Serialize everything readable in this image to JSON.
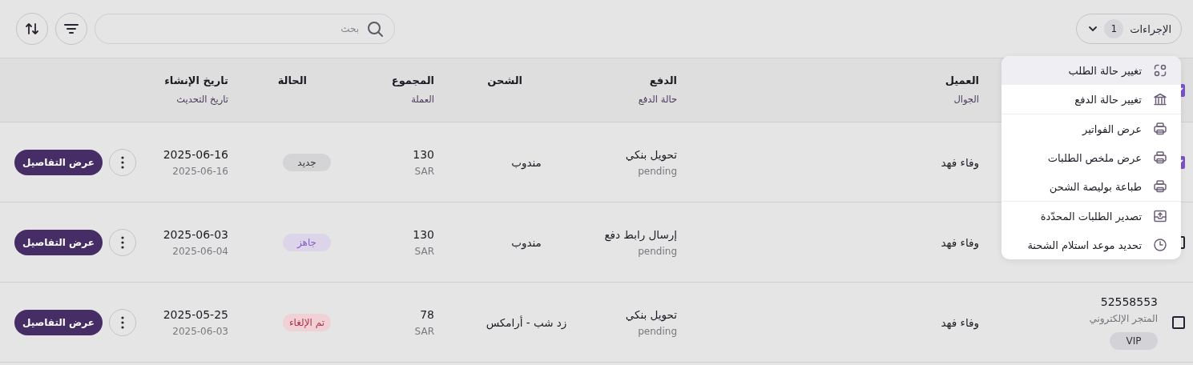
{
  "toolbar": {
    "actions_button": {
      "label": "الإجراءات",
      "count": "1"
    },
    "search": {
      "placeholder": "بحث"
    }
  },
  "table": {
    "header_checkbox": {
      "checked": true
    },
    "columns": [
      {
        "title": "العميل",
        "subtitle": "الجوال"
      },
      {
        "title": "الدفع",
        "subtitle": "حالة الدفع"
      },
      {
        "title": "الشحن"
      },
      {
        "title": "المجموع",
        "subtitle": "العملة"
      },
      {
        "title": "الحالة"
      },
      {
        "title": "تاريخ الإنشاء",
        "subtitle": "تاريخ التحديث"
      }
    ],
    "rows": [
      {
        "checked": true,
        "customer": "وفاء فهد",
        "payment_method": "تحويل بنكي",
        "payment_status": "pending",
        "shipping": "مندوب",
        "total": "130",
        "currency": "SAR",
        "status": {
          "label": "جديد",
          "kind": "new"
        },
        "created": "2025-06-16",
        "updated": "2025-06-16",
        "details_button": "عرض التفاصيل"
      },
      {
        "checked": false,
        "customer": "وفاء فهد",
        "payment_method": "إرسال رابط دفع",
        "payment_status": "pending",
        "shipping": "مندوب",
        "total": "130",
        "currency": "SAR",
        "status": {
          "label": "جاهز",
          "kind": "ready"
        },
        "created": "2025-06-03",
        "updated": "2025-06-04",
        "details_button": "عرض التفاصيل"
      },
      {
        "checked": false,
        "order_number": "52558553",
        "source": "المتجر الإلكتروني",
        "tags": [
          "VIP"
        ],
        "customer": "وفاء فهد",
        "payment_method": "تحويل بنكي",
        "payment_status": "pending",
        "shipping": "زد شب - أرامكس",
        "total": "78",
        "currency": "SAR",
        "status": {
          "label": "تم الإلغاء",
          "kind": "cancelled"
        },
        "created": "2025-05-25",
        "updated": "2025-06-03",
        "details_button": "عرض التفاصيل"
      }
    ]
  },
  "menu": {
    "groups": [
      [
        {
          "label": "تغيير حالة الطلب",
          "kind": "status",
          "selected": true
        },
        {
          "label": "تغيير حالة الدفع",
          "kind": "bank",
          "selected": false
        }
      ],
      [
        {
          "label": "عرض الفواتير",
          "kind": "print",
          "selected": false
        },
        {
          "label": "عرض ملخص الطلبات",
          "kind": "print",
          "selected": false
        },
        {
          "label": "طباعة بوليصة الشحن",
          "kind": "print",
          "selected": false
        }
      ],
      [
        {
          "label": "تصدير الطلبات المحدّدة",
          "kind": "export",
          "selected": false
        },
        {
          "label": "تحديد موعد استلام الشحنة",
          "kind": "clock",
          "selected": false
        }
      ]
    ]
  }
}
